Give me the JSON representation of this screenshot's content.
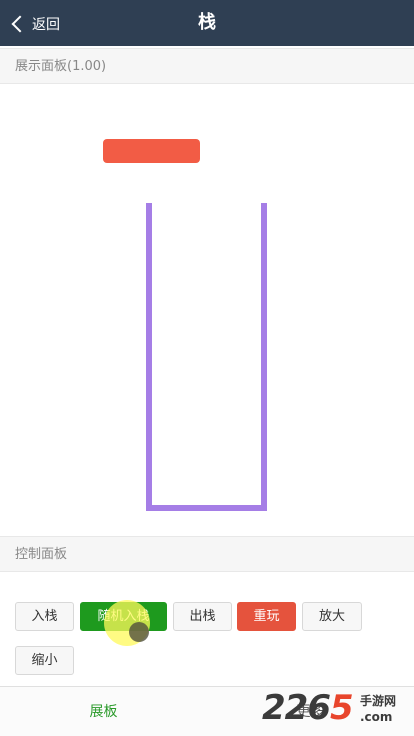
{
  "header": {
    "back_label": "返回",
    "title": "栈"
  },
  "display_panel": {
    "title": "展示面板(1.00)"
  },
  "control_panel": {
    "title": "控制面板",
    "buttons": [
      {
        "label": "入栈",
        "style": "default"
      },
      {
        "label": "随机入栈",
        "style": "green"
      },
      {
        "label": "出栈",
        "style": "default"
      },
      {
        "label": "重玩",
        "style": "red"
      },
      {
        "label": "放大",
        "style": "default"
      },
      {
        "label": "缩小",
        "style": "default"
      }
    ]
  },
  "tabbar": {
    "tabs": [
      {
        "label": "展板",
        "active": true
      },
      {
        "label": "更多",
        "active": false
      }
    ]
  },
  "watermark": {
    "number": "2265",
    "sub": "手游网",
    "domain": ".com"
  },
  "colors": {
    "header_bg": "#2f3f53",
    "pointer": "#f25c45",
    "stack_outline": "#a57ee6",
    "green_button": "#1e9a1e",
    "red_button": "#e5533d",
    "active_tab": "#2a9a2a"
  }
}
